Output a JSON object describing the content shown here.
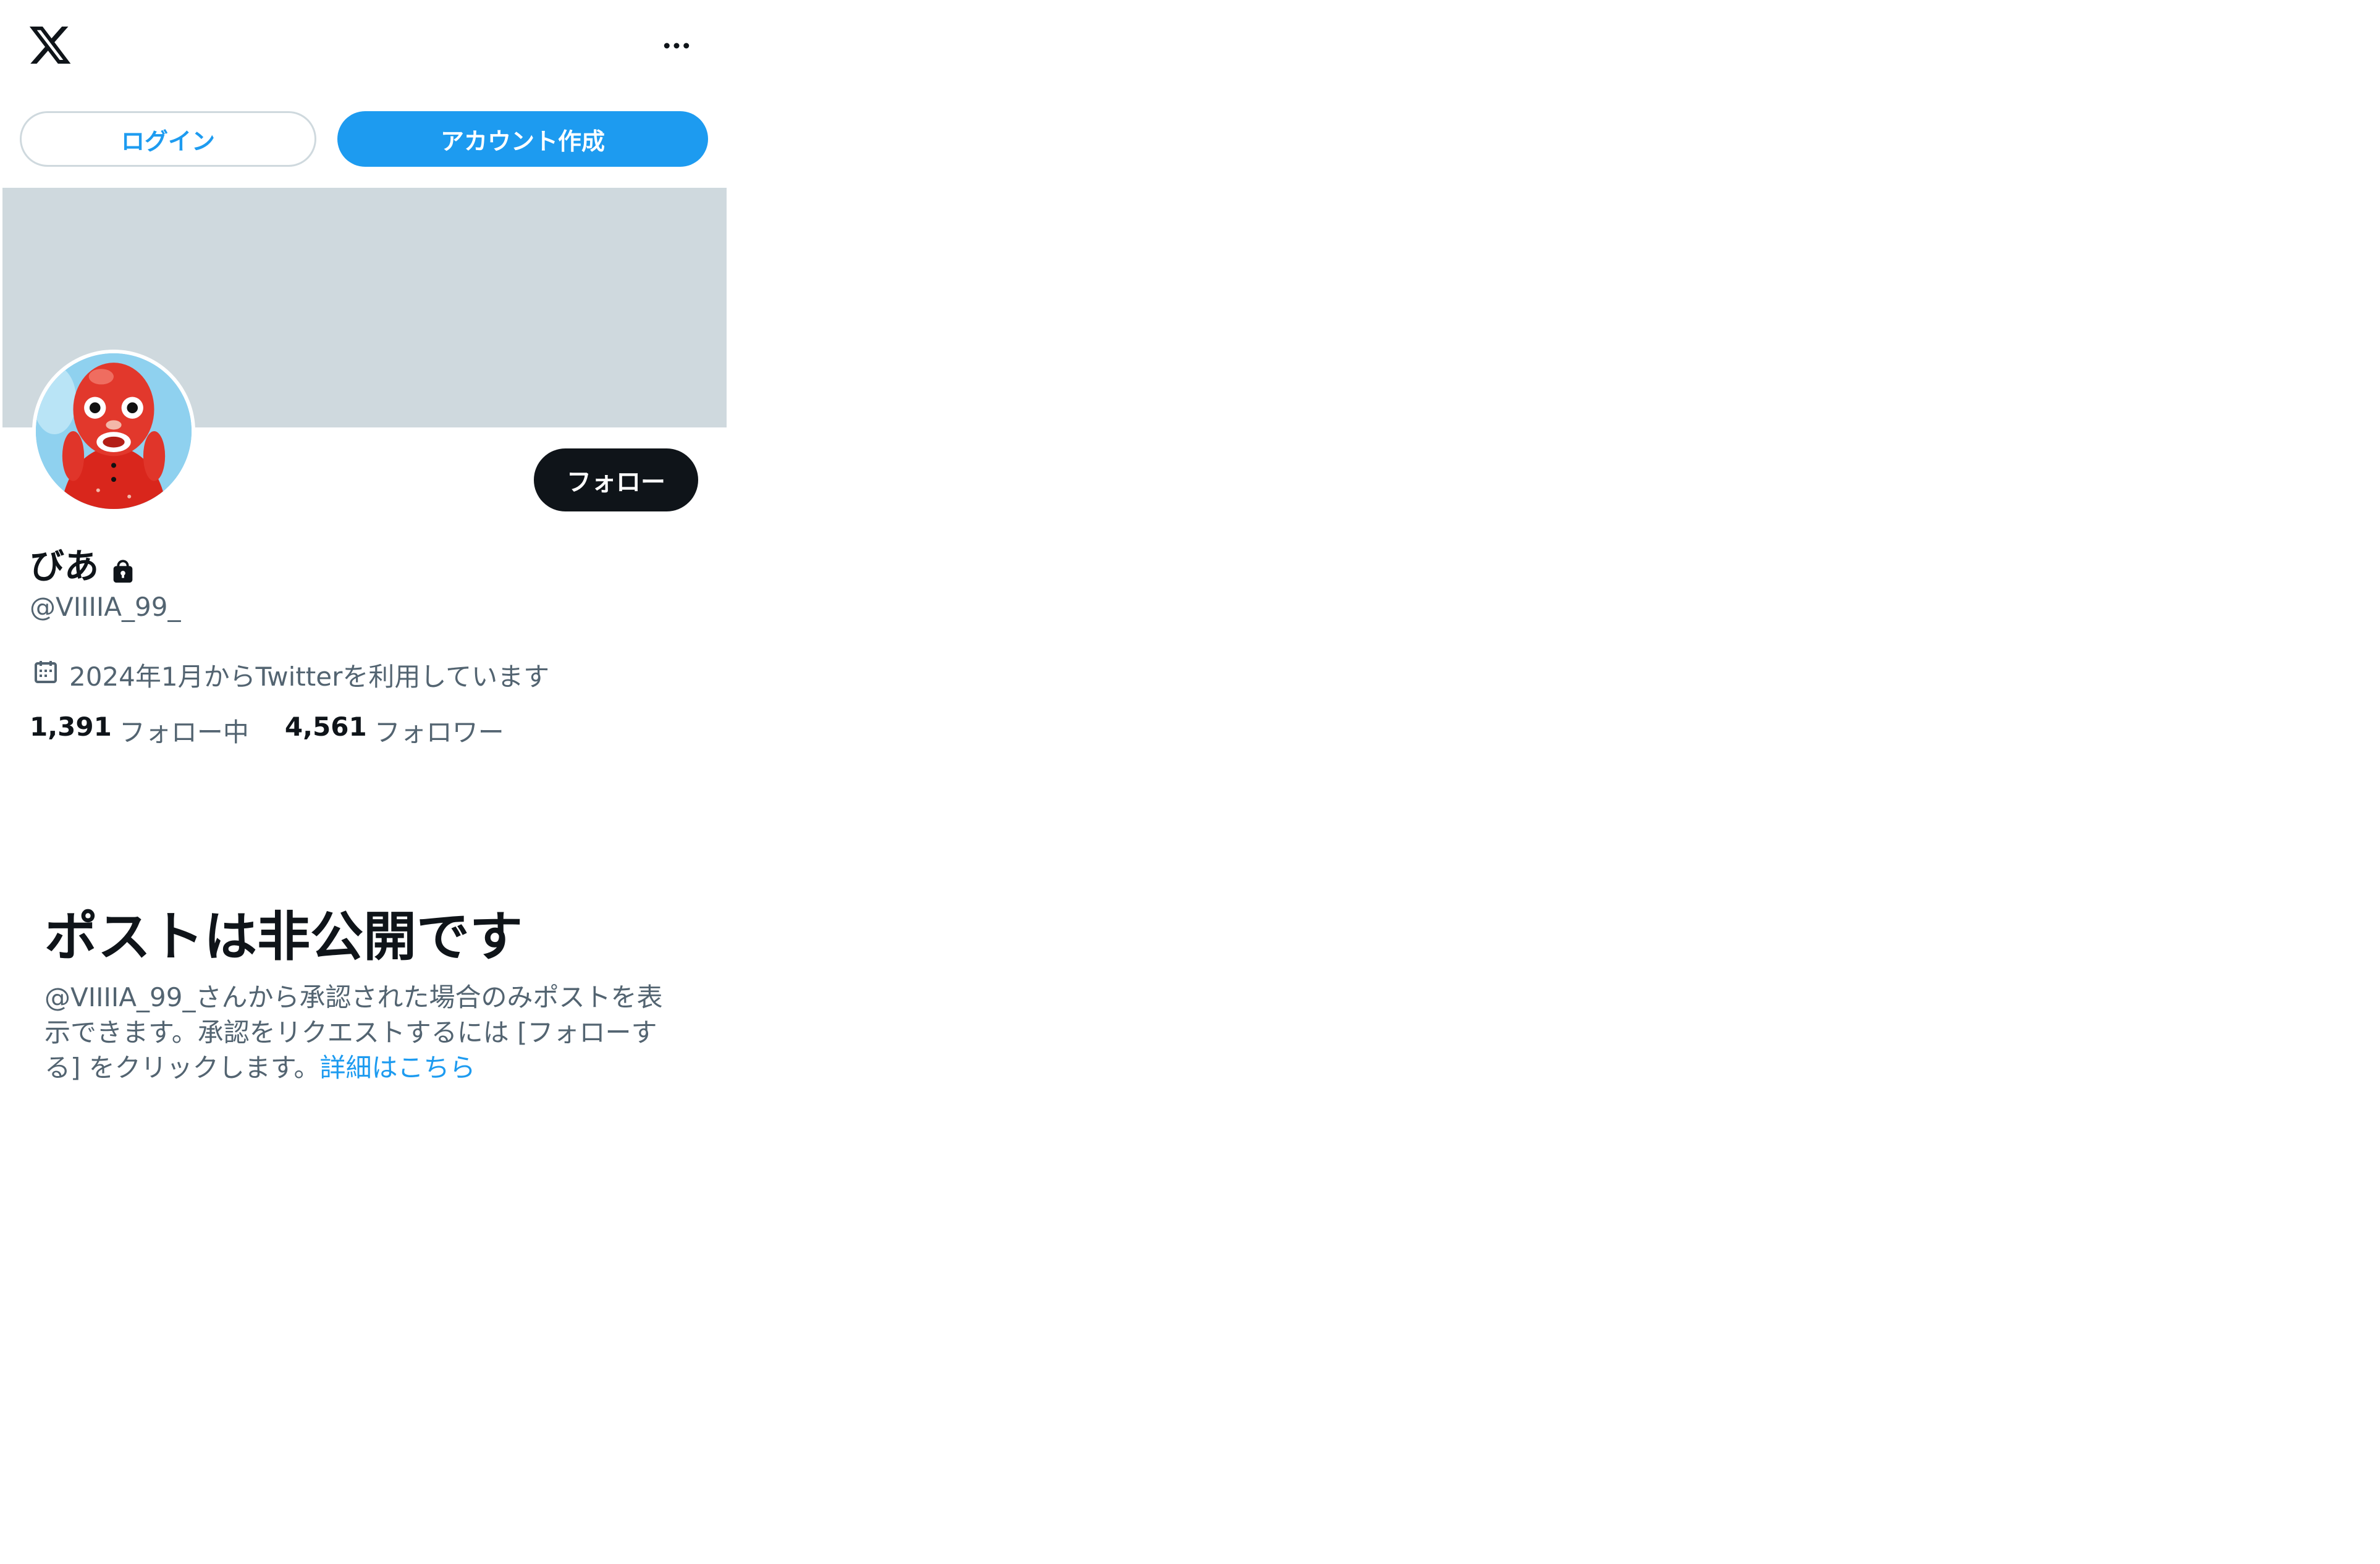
{
  "header": {
    "logo_icon": "x-logo-icon",
    "more_icon": "more-horizontal-icon"
  },
  "auth": {
    "login_label": "ログイン",
    "signup_label": "アカウント作成"
  },
  "profile": {
    "display_name": "びあ",
    "protected_icon": "lock-icon",
    "handle": "@VIIIIA_99_",
    "follow_label": "フォロー",
    "joined": "2024年1月からTwitterを利用しています",
    "following_count": "1,391",
    "following_label": "フォロー中",
    "followers_count": "4,561",
    "followers_label": "フォロワー"
  },
  "private_notice": {
    "title": "ポストは非公開です",
    "description": "@VIIIIA_99_さんから承認された場合のみポストを表示できます。承認をリクエストするには [フォローする] をクリックします。",
    "link_label": "詳細はこちら"
  },
  "colors": {
    "accent": "#1d9bf0",
    "banner": "#cfd9de",
    "text_primary": "#0f1419",
    "text_secondary": "#536471"
  }
}
